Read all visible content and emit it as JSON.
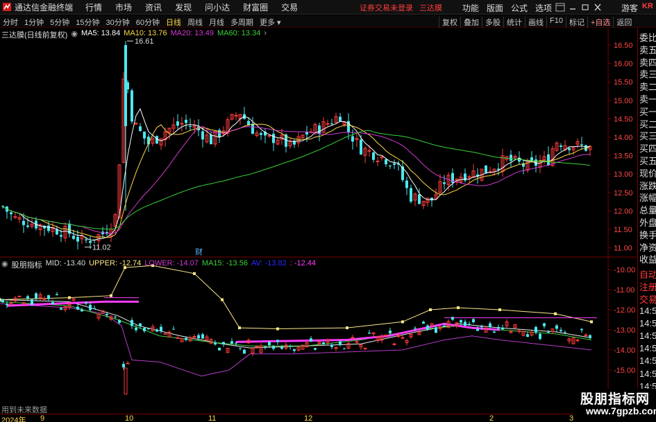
{
  "app": {
    "title": "通达信金融终端",
    "menu": [
      "行情",
      "市场",
      "资讯",
      "发现",
      "问小达",
      "财富圈",
      "交易"
    ],
    "login_status": "证券交易未登录",
    "stock_tag": "三达膜",
    "right_menu": [
      "功能",
      "版面",
      "公式",
      "选项"
    ],
    "guest": "游客",
    "kr": "KR"
  },
  "periods": {
    "tabs": [
      "分时",
      "1分钟",
      "5分钟",
      "15分钟",
      "30分钟",
      "60分钟",
      "日线",
      "周线",
      "月线",
      "多周期",
      "更多"
    ],
    "active": "日线"
  },
  "tools": [
    "复权",
    "叠加",
    "多股",
    "统计",
    "画线",
    "F10",
    "标记",
    "+自选",
    "返回"
  ],
  "main_legend": {
    "name": "三达膜(日线前复权)",
    "ma5": "MA5: 13.84",
    "ma10": "MA10: 13.76",
    "ma20": "MA20: 13.49",
    "ma60": "MA60: 13.34"
  },
  "indicator_legend": {
    "name": "股朋指标",
    "mid": "MID: -13.40",
    "upper": "UPPER: -12.74",
    "lower": "LOWER: -14.07",
    "ma15": "MA15: -13.56",
    "av": "AV: -13.82",
    "av2": ": -12.44"
  },
  "annotations": {
    "high": "16.61",
    "low": "11.02",
    "cai": "财"
  },
  "price_axis": [
    "16.50",
    "16.00",
    "15.50",
    "15.00",
    "14.50",
    "14.00",
    "13.50",
    "13.00",
    "12.50",
    "12.00",
    "11.50",
    "11.00"
  ],
  "ind_axis": [
    "-10.00",
    "-11.00",
    "-12.00",
    "-13.00",
    "-14.00",
    "-15.00"
  ],
  "sidebar_top": [
    "委比",
    "卖五",
    "卖四",
    "卖三",
    "卖二",
    "卖一",
    "买一",
    "买二",
    "买三",
    "买四",
    "买五",
    "现价",
    "涨跌",
    "涨幅",
    "总量",
    "外盘",
    "换手",
    "净资",
    "收益"
  ],
  "sidebar_bottom": [
    "自动",
    "注册",
    "交易",
    "14:55",
    "14:55",
    "14:56",
    "14:56",
    "14:56",
    "14:56",
    "14:56"
  ],
  "dates": {
    "year": "2024年",
    "m9": "9",
    "m10": "10",
    "m11": "11",
    "m12": "12",
    "m2": "2",
    "m3": "3"
  },
  "footer_note": "用到未来数据",
  "watermark": {
    "title": "股朋指标网",
    "url": "www.7gpzb.com"
  },
  "colors": {
    "up": "#ff3c3c",
    "down": "#4ce8f0",
    "ma5": "#ffffff",
    "ma10": "#ffd84a",
    "ma20": "#d23ad2",
    "ma60": "#3ad23a",
    "upper": "#ffe98a",
    "lower": "#b43cc8",
    "highlight": "#ff3cff"
  }
}
